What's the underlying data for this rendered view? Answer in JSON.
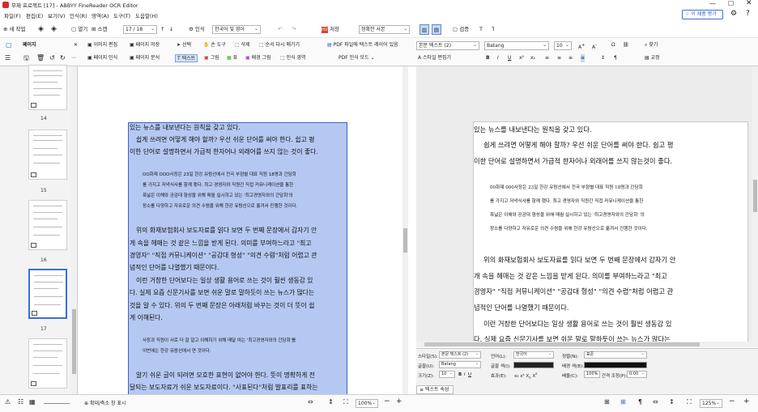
{
  "app": {
    "title": "무제 프로젝트 [17] - ABBYY FineReader OCR Editor",
    "rate_button": "이 제품 평가"
  },
  "menu": [
    "파일(F)",
    "편집(E)",
    "보기(V)",
    "인식(R)",
    "영역(A)",
    "도구(T)",
    "도움말(H)"
  ],
  "toolbar": {
    "new": "새 작업",
    "open": "열기",
    "scan": "스캔",
    "page_counter": "17 / 18",
    "recognize": "인식",
    "language": "한국어 및 영어",
    "save": "저장",
    "save_mode": "정확한 사본",
    "verify": "검증"
  },
  "ribbon_left": {
    "title": "페이지",
    "edit_image": "이미지 편집",
    "save_page": "페이지 저장",
    "recognize_page": "페이지 인식",
    "analyze_page": "페이지 분석"
  },
  "ribbon_mid": {
    "select": "선택",
    "hand": "손 도구",
    "delete": "삭제",
    "reorder": "순서 다시 매기기",
    "text": "텍스트",
    "picture": "그림",
    "table": "표",
    "background": "배경 그림",
    "recognition_area": "인식 영역",
    "pdf_text_layer": "PDF 파일에 텍스트 레이어 있음",
    "pdf_mode": "PDF 인식 모드"
  },
  "ribbon_right": {
    "style": "본문 텍스트 (2)",
    "style_editor": "스타일 편집기",
    "font": "Batang",
    "size": "10",
    "find": "찾기",
    "correct": "교정"
  },
  "thumbnails": [
    {
      "num": "14"
    },
    {
      "num": "15"
    },
    {
      "num": "16"
    },
    {
      "num": "17"
    },
    {
      "num": "18"
    }
  ],
  "image_lines": [
    "있는 뉴스를 내보낸다는 원칙을 갖고 있다.",
    "쉽게 쓰려면 어떻게 해야 할까? 우선 쉬운 단어를 써야 한다. 쉽고 평",
    "이한 단어로 설명하면서 가급적 한자어나 외래어를 쓰지 않는 것이 좋다."
  ],
  "image_quote": [
    "OO화재 OOO사장은 23일 한강 유람선에서 전국 부점별 대표 직원 18명과 간담회",
    "를 가지고 저녁식사를 함께 했다. 최고 경영자와 직원간 직접 커뮤니케이션을 통한",
    "폭넓은 이해와 공감대 형성을 위해 매월 실시하고 있는 '최고경영자와의 간담회'의",
    "장소를 다양하고 자유로운 의견 수렴을 위해 한강 유람선으로 옮겨서 진행한 것이다."
  ],
  "image_lines2": [
    "위의 화재보험회사 보도자료를 읽다 보면 두 번째 문장에서 갑자기 안",
    "게 속을 헤매는 것 같은 느낌을 받게 된다. 의미를 부여하느라고 \"최고",
    "경영자\" \"직접 커뮤니케이션\" \"공감대 형성\" \"의견 수렴\"처럼 어렵고 관",
    "념적인 단어를 나열했기 때문이다.",
    "이런 거창한 단어보다는 일상 생활 용어로 쓰는 것이 훨씬 생동감 있",
    "다. 실제 요즘 신문기사를 보면 쉬운 말로 말하듯이 쓰는 뉴스가 많다는",
    "것을 알 수 있다. 위의 두 번째 문장은 아래처럼 바꾸는 것이 더 뜻이 쉽",
    "게 이해된다."
  ],
  "image_quote2": [
    "사장과 직원이 서로 더 잘 알고 이해하기 위해 매달 여는 '최고경영자와의 간담회'를",
    "이번에는 한강 유람선에서 연 것이다."
  ],
  "image_lines3": [
    "알기 쉬운 글이 되려면 모호한 표현이 없어야 한다. 뜻이 명확하게 전",
    "달되는 보도자료가 쉬운 보도자료이다. \"사표된다\"처럼 발표리를 표하는"
  ],
  "text_lines": [
    "있는 뉴스를 내보낸다는 원칙을 갖고 있다.",
    "쉽게 쓰려면 어떻게 해야 할까? 우선 쉬운 단어를 써야 한다. 쉽고 평",
    "이한 단어로 설명하면서 가급적 한자어나 외래어를 쓰지 않는것이 좋다."
  ],
  "text_quote": [
    "00화재 000사장은 23일 한강 유람선에서 전국 부점별 대표 직원 18명과 간담회",
    "를 가지고 저녁식사를 함께 했다. 최고 경영자와 직원간 직접 커뮤니케이션을 통한",
    "폭넓은 이해와 공감대 형성을 위해 매월 실시하고 있는 '최고경영자와의 간담회' 의",
    "장소를 다양하고 자유로운 의견 수렴을 위해 한강 유람선으로 옮겨서 진행한 것이다."
  ],
  "text_lines2": [
    "위의 화재보험회사 보도자료를 읽다 보면 두 번째 문장에서 갑자기 안",
    "개 속을 헤매는 것 같은 느낌을 받게 된다. 의미를 부여하느라고 \"최고",
    "경영자\" \"직접 커뮤니케이션\" \"공감대 형성\" \"의견 수렴\"처럼 어렵고 관",
    "념적인 단어를 나열했기 때문이다.",
    "이런 거창한 단어보다는 일상 생활 용어로 쓰는 것이 훨씬 생동감 있",
    "다. 실제 요즘 신문기사를 보면 쉬운 말로 말하듯이 쓰는 뉴스가 많다는"
  ],
  "props": {
    "style_label": "스타일(S):",
    "style_val": "본문 텍스트 (2)",
    "font_label": "글꼴(U):",
    "font_val": "Batang",
    "size_label": "크기(Z):",
    "size_val": "10",
    "lang_label": "언어(L):",
    "lang_val": "한국어",
    "color_label": "글꼴 색(I):",
    "bg_label": "배경 색(B):",
    "effect_label": "효과(E):",
    "align_label": "정렬(N):",
    "align_val": "표준",
    "scale_label": "배율(C):",
    "scale_val": "100%",
    "spacing_label": "간격 조정(P):",
    "spacing_val": "0.00",
    "tab_label": "텍스트 속성"
  },
  "status": {
    "zoom_label": "확대/축소 창 표시",
    "zoom_left": "100%",
    "zoom_right": "125%"
  }
}
